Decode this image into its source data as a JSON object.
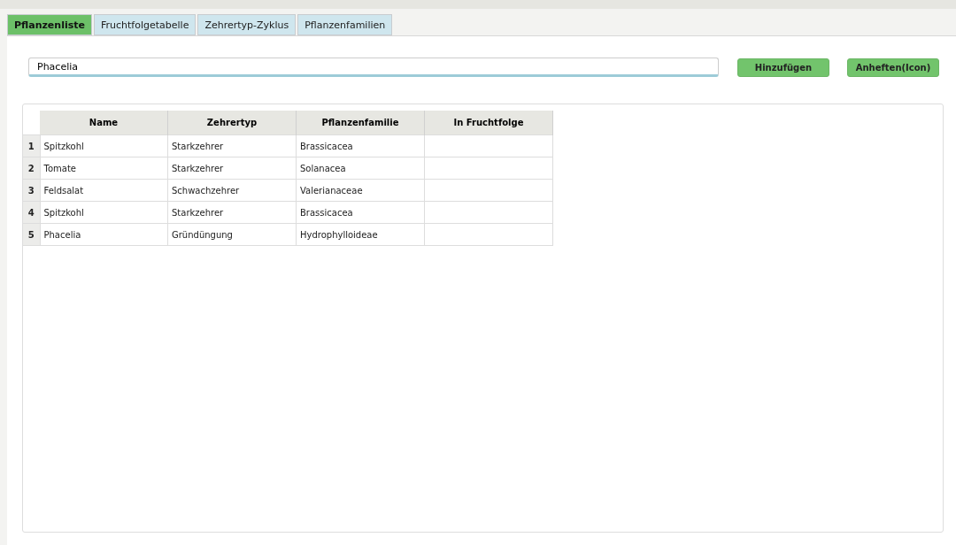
{
  "tabs": [
    {
      "label": "Pflanzenliste",
      "selected": true
    },
    {
      "label": "Fruchtfolgetabelle",
      "selected": false
    },
    {
      "label": "Zehrertyp-Zyklus",
      "selected": false
    },
    {
      "label": "Pflanzenfamilien",
      "selected": false
    }
  ],
  "search": {
    "value": "Phacelia"
  },
  "buttons": [
    "Hinzufügen",
    "Anheften(Icon)"
  ],
  "table": {
    "columns": [
      "Name",
      "Zehrertyp",
      "Pflanzenfamilie",
      "In Fruchtfolge"
    ],
    "rows": [
      {
        "number": "1",
        "cells": [
          "Spitzkohl",
          "Starkzehrer",
          "Brassicacea"
        ]
      },
      {
        "number": "2",
        "cells": [
          "Tomate",
          "Starkzehrer",
          "Solanacea"
        ]
      },
      {
        "number": "3",
        "cells": [
          "Feldsalat",
          "Schwachzehrer",
          "Valerianaceae"
        ]
      },
      {
        "number": "4",
        "cells": [
          "Spitzkohl",
          "Starkzehrer",
          "Brassicacea"
        ]
      },
      {
        "number": "5",
        "cells": [
          "Phacelia",
          "Gründüngung",
          "Hydrophylloideae"
        ]
      }
    ]
  }
}
